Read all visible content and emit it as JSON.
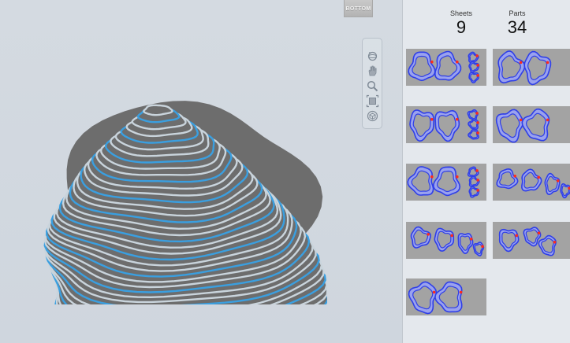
{
  "viewcube": {
    "face_label": "BOTTOM"
  },
  "nav_tools": [
    "orbit-icon",
    "pan-icon",
    "zoom-icon",
    "zoom-extents-icon",
    "home-cube-icon"
  ],
  "stats": {
    "sheets_label": "Sheets",
    "sheets_value": "9",
    "parts_label": "Parts",
    "parts_value": "34"
  },
  "sheets": [
    {
      "id": "sheet-1",
      "parts": 5
    },
    {
      "id": "sheet-2",
      "parts": 2
    },
    {
      "id": "sheet-3",
      "parts": 5
    },
    {
      "id": "sheet-4",
      "parts": 2
    },
    {
      "id": "sheet-5",
      "parts": 5
    },
    {
      "id": "sheet-6",
      "parts": 4
    },
    {
      "id": "sheet-7",
      "parts": 4
    },
    {
      "id": "sheet-8",
      "parts": 3
    },
    {
      "id": "sheet-9",
      "parts": 2
    }
  ],
  "colors": {
    "model_body": "#6d6d6d",
    "model_slice_edge": "#c9d4dc",
    "model_outline": "#3a9fe0",
    "part_fill": "#9aa2ee",
    "part_cut_line": "#2f3fe8",
    "part_marker": "#ff2a1a",
    "sheet_bg": "#a3a3a3"
  }
}
